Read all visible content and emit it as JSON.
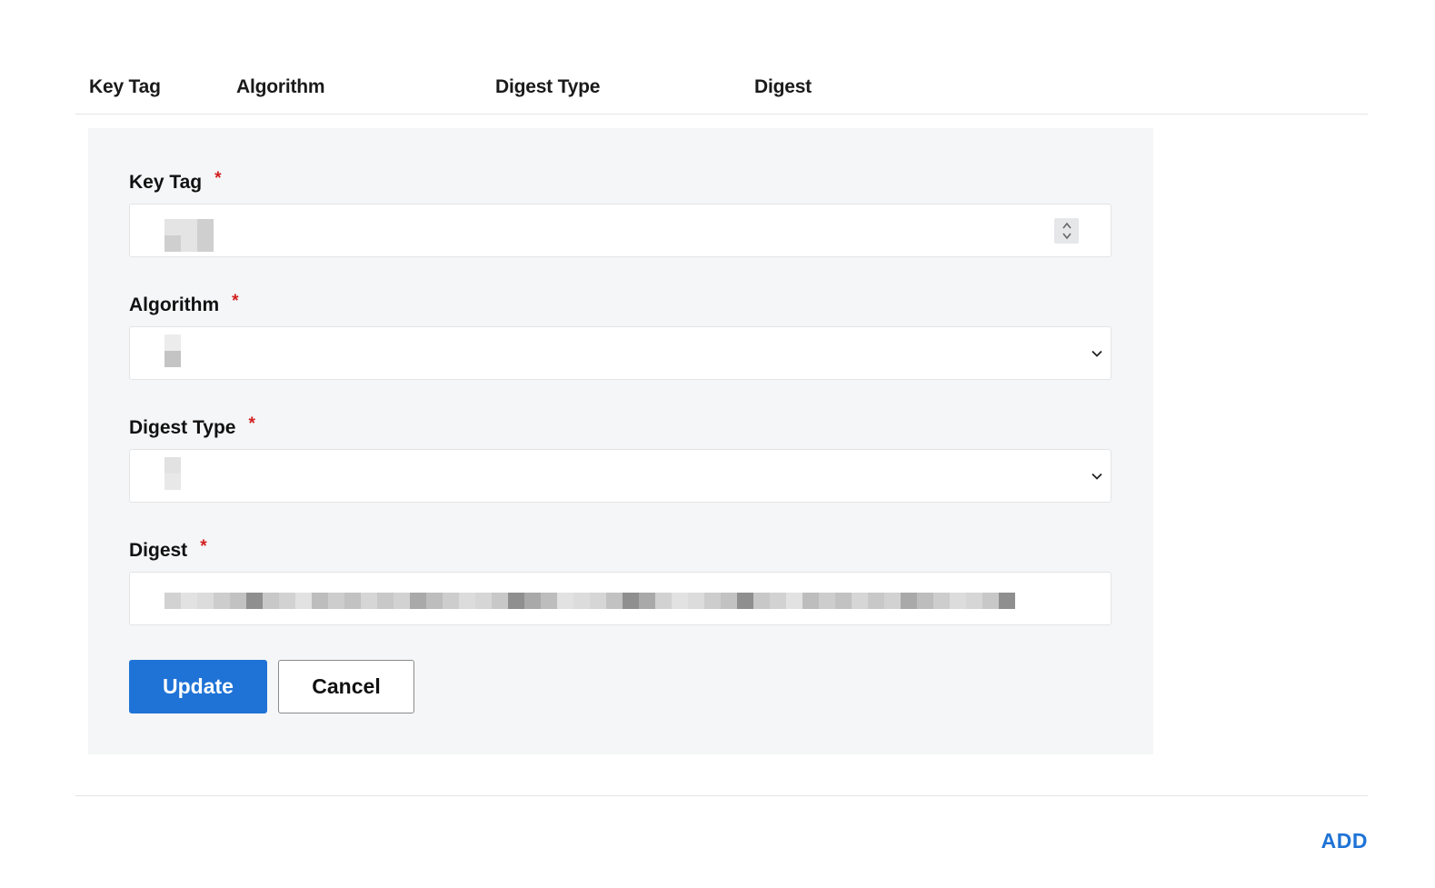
{
  "table": {
    "columns": [
      "Key Tag",
      "Algorithm",
      "Digest Type",
      "Digest"
    ]
  },
  "form": {
    "key_tag": {
      "label": "Key Tag",
      "required_marker": "*",
      "value": ""
    },
    "algorithm": {
      "label": "Algorithm",
      "required_marker": "*",
      "value": ""
    },
    "digest_type": {
      "label": "Digest Type",
      "required_marker": "*",
      "value": ""
    },
    "digest": {
      "label": "Digest",
      "required_marker": "*",
      "value": ""
    }
  },
  "buttons": {
    "update": "Update",
    "cancel": "Cancel"
  },
  "add_link": "ADD",
  "icons": {
    "spinner": "number-stepper-icon",
    "algorithm_dropdown": "chevron-down-icon",
    "digest_type_dropdown": "chevron-down-icon"
  },
  "colors": {
    "primary": "#1f73d6",
    "required": "#d31f1f",
    "panel_bg": "#f5f6f7"
  }
}
